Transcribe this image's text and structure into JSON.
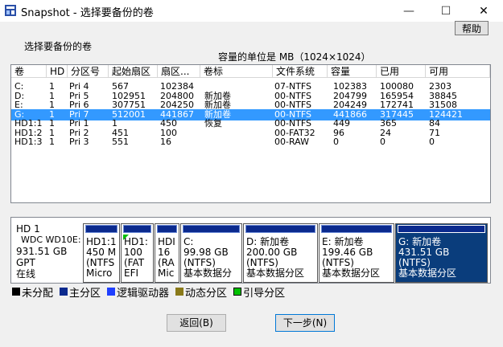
{
  "window": {
    "title": "Snapshot - 选择要备份的卷",
    "min_glyph": "—",
    "max_glyph": "☐",
    "close_glyph": "✕"
  },
  "help_label": "帮助",
  "select_label": "选择要备份的卷",
  "unit_note": "容量的单位是 MB（1024×1024）",
  "table": {
    "columns": [
      "卷",
      "HD",
      "分区号",
      "起始扇区",
      "扇区...",
      "卷标",
      "文件系统",
      "容量",
      "已用",
      "可用"
    ],
    "rows": [
      [
        "C:",
        "1",
        "Pri  4",
        "567",
        "102384",
        "",
        "07-NTFS",
        "102383",
        "100080",
        "2303"
      ],
      [
        "D:",
        "1",
        "Pri  5",
        "102951",
        "204800",
        "新加卷",
        "00-NTFS",
        "204799",
        "165954",
        "38845"
      ],
      [
        "E:",
        "1",
        "Pri  6",
        "307751",
        "204250",
        "新加卷",
        "00-NTFS",
        "204249",
        "172741",
        "31508"
      ],
      [
        "G:",
        "1",
        "Pri  7",
        "512001",
        "441867",
        "新加卷",
        "00-NTFS",
        "441866",
        "317445",
        "124421"
      ],
      [
        "HD1:1",
        "1",
        "Pri  1",
        "1",
        "450",
        "恢复",
        "00-NTFS",
        "449",
        "365",
        "84"
      ],
      [
        "HD1:2",
        "1",
        "Pri  2",
        "451",
        "100",
        "",
        "00-FAT32",
        "96",
        "24",
        "71"
      ],
      [
        "HD1:3",
        "1",
        "Pri  3",
        "551",
        "16",
        "",
        "00-RAW",
        "0",
        "0",
        "0"
      ]
    ],
    "selected_row": 3
  },
  "disk": {
    "info": [
      "HD 1",
      "WDC WD10E:",
      "931.51 GB",
      "GPT",
      "在线"
    ],
    "partitions": [
      {
        "lines": [
          "HD1:1",
          "450 M",
          "(NTFS",
          "Micro"
        ]
      },
      {
        "lines": [
          "HD1:",
          "100",
          "(FAT",
          "EFI"
        ]
      },
      {
        "lines": [
          "HDI",
          "16",
          "(RA",
          "Mic"
        ]
      },
      {
        "lines": [
          "C:",
          "99.98 GB",
          "(NTFS)",
          "基本数据分"
        ]
      },
      {
        "lines": [
          "D: 新加卷",
          "200.00 GB",
          "(NTFS)",
          "基本数据分区"
        ]
      },
      {
        "lines": [
          "E: 新加卷",
          "199.46 GB",
          "(NTFS)",
          "基本数据分区"
        ]
      },
      {
        "lines": [
          "G: 新加卷",
          "431.51 GB",
          "(NTFS)",
          "基本数据分区"
        ]
      }
    ]
  },
  "legend": [
    {
      "label": "未分配",
      "color": "#000000"
    },
    {
      "label": "主分区",
      "color": "#0b2a8e"
    },
    {
      "label": "逻辑驱动器",
      "color": "#1f3fff"
    },
    {
      "label": "动态分区",
      "color": "#8a7a1a"
    },
    {
      "label": "引导分区",
      "color": "#00c000"
    }
  ],
  "buttons": {
    "back": "返回(B)",
    "next": "下一步(N)"
  }
}
